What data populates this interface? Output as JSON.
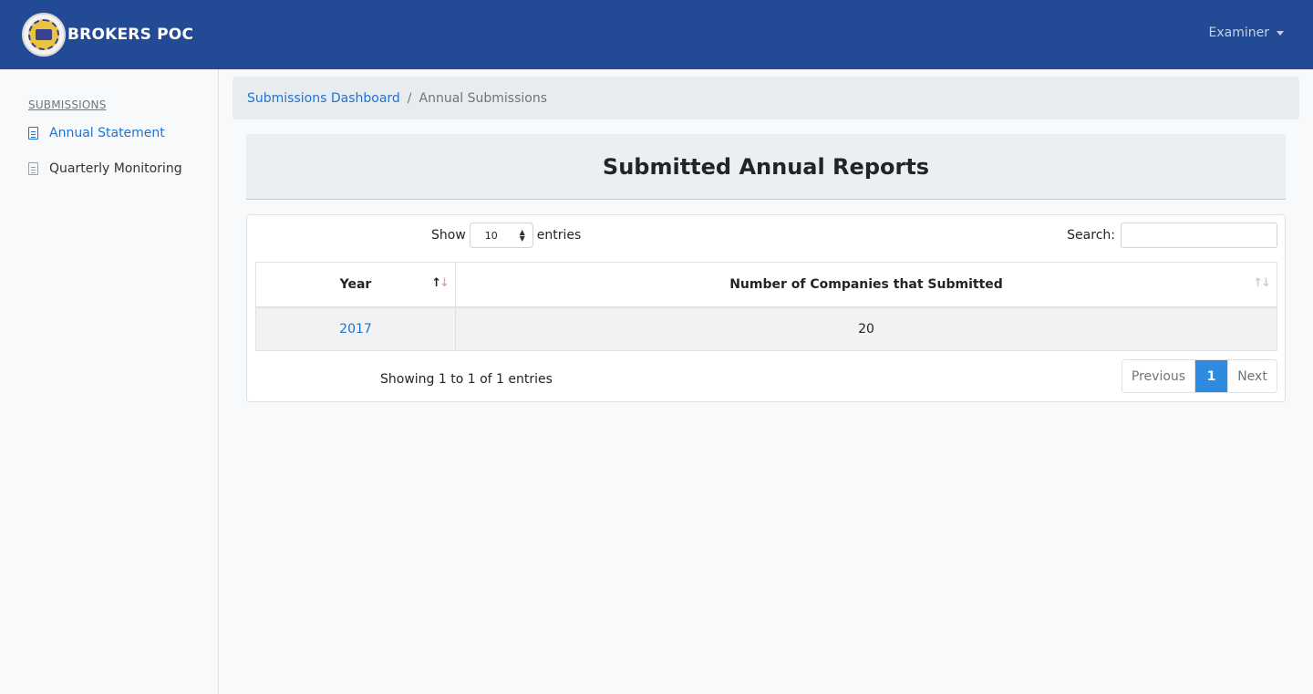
{
  "app": {
    "brand": "BROKERS POC"
  },
  "user": {
    "name": "Examiner"
  },
  "sidebar": {
    "heading": "SUBMISSIONS",
    "items": [
      {
        "label": "Annual Statement",
        "active": true
      },
      {
        "label": "Quarterly Monitoring",
        "active": false
      }
    ]
  },
  "breadcrumb": {
    "link": "Submissions Dashboard",
    "separator": "/",
    "current": "Annual Submissions"
  },
  "page": {
    "title": "Submitted Annual Reports"
  },
  "table_controls": {
    "show_label": "Show",
    "entries_value": "10",
    "entries_label": "entries",
    "search_label": "Search:",
    "search_value": ""
  },
  "table": {
    "columns": [
      "Year",
      "Number of Companies that Submitted"
    ],
    "rows": [
      {
        "year": "2017",
        "count": "20"
      }
    ]
  },
  "footer": {
    "info": "Showing 1 to 1 of 1 entries",
    "prev": "Previous",
    "page": "1",
    "next": "Next"
  },
  "colors": {
    "navbar": "#234a94",
    "link": "#1f72d6",
    "active_page": "#2f8be0"
  }
}
